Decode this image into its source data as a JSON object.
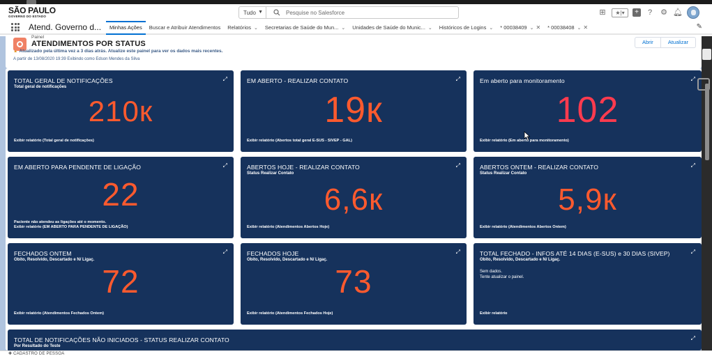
{
  "brand": {
    "line1": "SÃO PAULO",
    "line2": "GOVERNO DO ESTADO"
  },
  "search": {
    "scope": "Tudo",
    "placeholder": "Pesquise no Salesforce"
  },
  "header_icons": [
    "favorites-star-icon",
    "dropdown-icon",
    "add-icon",
    "help-icon",
    "setup-gear-icon",
    "notifications-bell-icon"
  ],
  "nav": {
    "app_name": "Atend. Governo d...",
    "items": [
      {
        "label": "Minhas Ações",
        "active": true,
        "has_menu": false,
        "closable": false
      },
      {
        "label": "Buscar e Atribuir Atendimentos",
        "active": false,
        "has_menu": false,
        "closable": false
      },
      {
        "label": "Relatórios",
        "active": false,
        "has_menu": true,
        "closable": false
      },
      {
        "label": "Secretarias de Saúde do Mun...",
        "active": false,
        "has_menu": true,
        "closable": false
      },
      {
        "label": "Unidades de Saúde do Munic...",
        "active": false,
        "has_menu": true,
        "closable": false
      },
      {
        "label": "Históricos de Logins",
        "active": false,
        "has_menu": true,
        "closable": false
      },
      {
        "label": "* 00038409",
        "active": false,
        "has_menu": true,
        "closable": true
      },
      {
        "label": "* 00038408",
        "active": false,
        "has_menu": true,
        "closable": true
      }
    ]
  },
  "dashboard": {
    "type_label": "Painel",
    "title": "ATENDIMENTOS POR STATUS",
    "warning": "Atualizado pela última vez a 3 dias atrás. Atualize este painel para ver os dados mais recentes.",
    "meta": "A partir de 13/08/2020 19:39 Exibindo como Edson Mendes da Silva",
    "buttons": {
      "open": "Abrir",
      "refresh": "Atualizar"
    }
  },
  "tiles": [
    {
      "title": "TOTAL GERAL DE NOTIFICAÇÕES",
      "subtitle": "Total geral de notificações",
      "value": "210к",
      "value_color": "#ff5a2e",
      "footer": "Exibir relatório (Total geral de notificações)"
    },
    {
      "title": "EM ABERTO - REALIZAR CONTATO",
      "subtitle": "",
      "value": "19к",
      "value_color": "#ff5a2e",
      "footer": "Exibir relatório (Abertos total geral E-SUS - SIVEP - GAL)"
    },
    {
      "title": "Em aberto para monitoramento",
      "subtitle": "",
      "value": "102",
      "value_color": "#ff3b4e",
      "footer": "Exibir relatório (Em aberto para monitoramento)"
    },
    {
      "title": "EM ABERTO PARA PENDENTE DE LIGAÇÃO",
      "subtitle": "",
      "value": "22",
      "value_color": "#ff5a2e",
      "footer_note": "Paciente não atendeu as ligações até o momento.",
      "footer": "Exibir relatório (EM ABERTO PARA PENDENTE DE LIGAÇÃO)"
    },
    {
      "title": "ABERTOS HOJE - REALIZAR CONTATO",
      "subtitle": "Status Realizar Contato",
      "value": "6,6к",
      "value_color": "#ff5a2e",
      "footer": "Exibir relatório (Atendimentos Abertos Hoje)"
    },
    {
      "title": "ABERTOS ONTEM - REALIZAR CONTATO",
      "subtitle": "Status Realizar Contato",
      "value": "5,9к",
      "value_color": "#ff5a2e",
      "footer": "Exibir relatório (Atendimentos Abertos Ontem)"
    },
    {
      "title": "FECHADOS ONTEM",
      "subtitle": "Obito, Resolvido, Descartado e N/ Ligaç.",
      "value": "72",
      "value_color": "#ff5a2e",
      "footer": "Exibir relatório (Atendimentos Fechados Ontem)"
    },
    {
      "title": "FECHADOS HOJE",
      "subtitle": "Obito, Resolvido, Descartado e N/ Ligaç.",
      "value": "73",
      "value_color": "#ff5a2e",
      "footer": "Exibir relatório (Atendimentos Fechados Hoje)"
    },
    {
      "title": "TOTAL FECHADO - INFOS ATÉ 14 DIAS (E-SUS) e 30 DIAS (SIVEP)",
      "subtitle": "Obito, Resolvido, Descartado e N/ Ligaç.",
      "value": "",
      "no_data_1": "Sem dados.",
      "no_data_2": "Tente atualizar o painel.",
      "footer": "Exibir relatório"
    },
    {
      "title": "TOTAL DE NOTIFICAÇÕES NÃO INICIADOS - STATUS REALIZAR CONTATO",
      "subtitle": "Por Resultado do Teste"
    }
  ],
  "footer": {
    "utility_label": "CADASTRO DE PESSOA"
  },
  "colors": {
    "tile_bg": "#16325c",
    "value_orange": "#ff5a2e",
    "value_red": "#ff3b4e",
    "workspace_bg": "#b0c4df",
    "active_tab": "#0070d2"
  }
}
